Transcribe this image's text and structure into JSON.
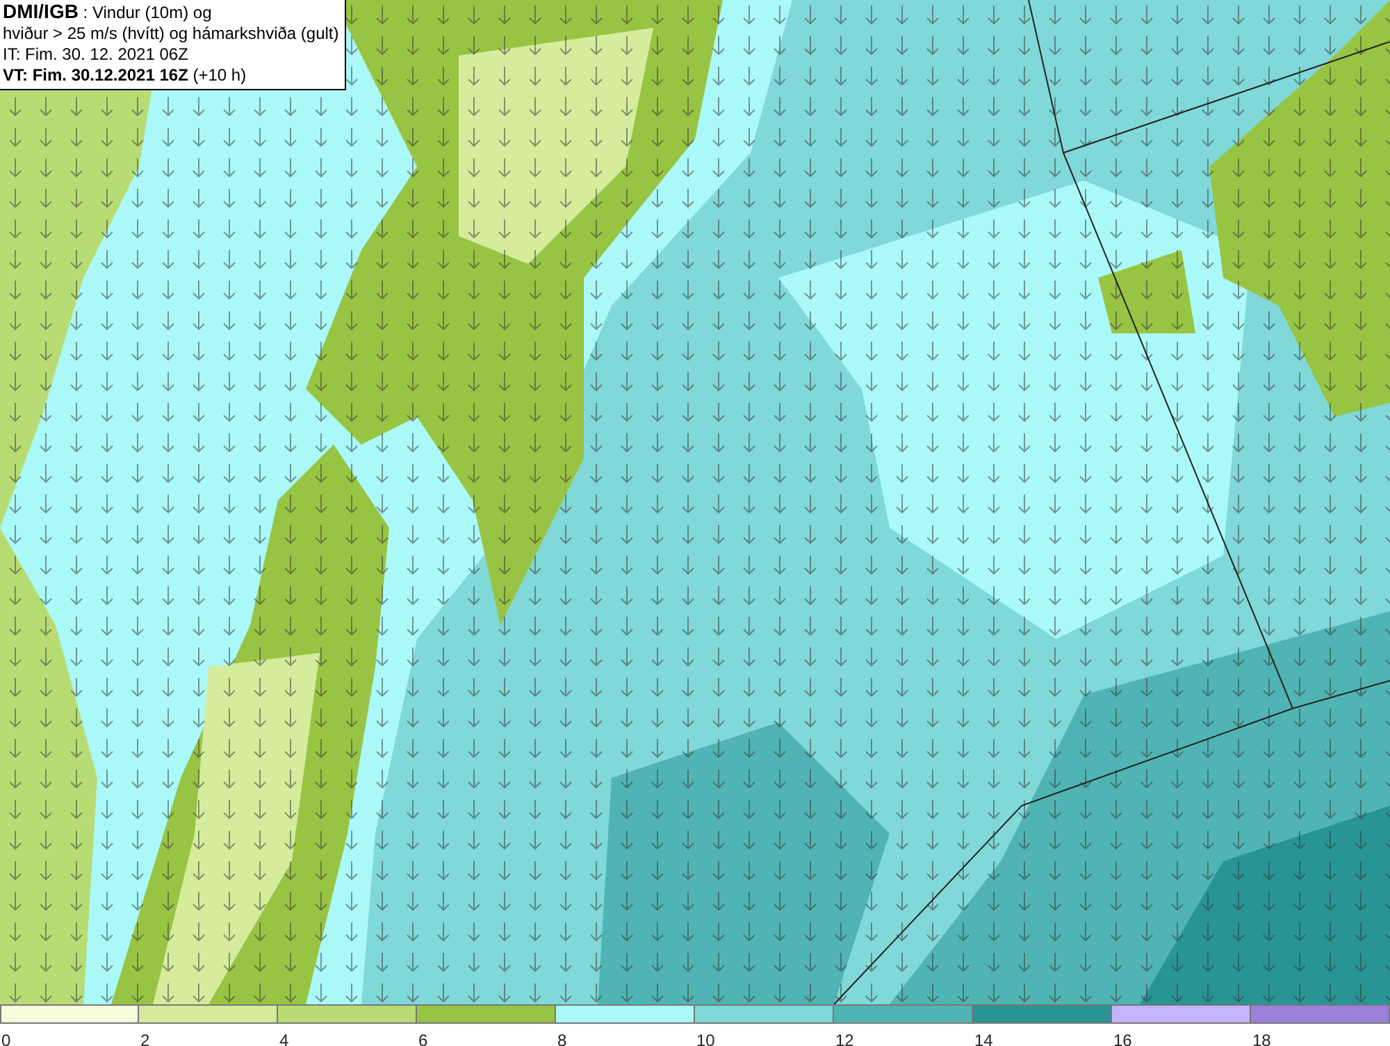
{
  "title_box": {
    "lines": [
      "**DMI/IGB** : Vindur (10m) og",
      "hviður > 25 m/s (hvítt) og hámarkshviða (gult)",
      "IT: Fim. 30. 12. 2021 06Z",
      "**VT: Fim. 30.12.2021 16Z** (+10 h)"
    ]
  },
  "legend": [
    {
      "label": "0",
      "color": "#f4fcdc"
    },
    {
      "label": "2",
      "color": "#d4ec9c"
    },
    {
      "label": "4",
      "color": "#b8dc74"
    },
    {
      "label": "6",
      "color": "#98c444"
    },
    {
      "label": "8",
      "color": "#aaf8f8"
    },
    {
      "label": "10",
      "color": "#80d8d8"
    },
    {
      "label": "12",
      "color": "#50b4b4"
    },
    {
      "label": "14",
      "color": "#289494"
    },
    {
      "label": "16",
      "color": "#c4b4fc"
    },
    {
      "label": "18",
      "color": "#9c80dc"
    }
  ]
}
